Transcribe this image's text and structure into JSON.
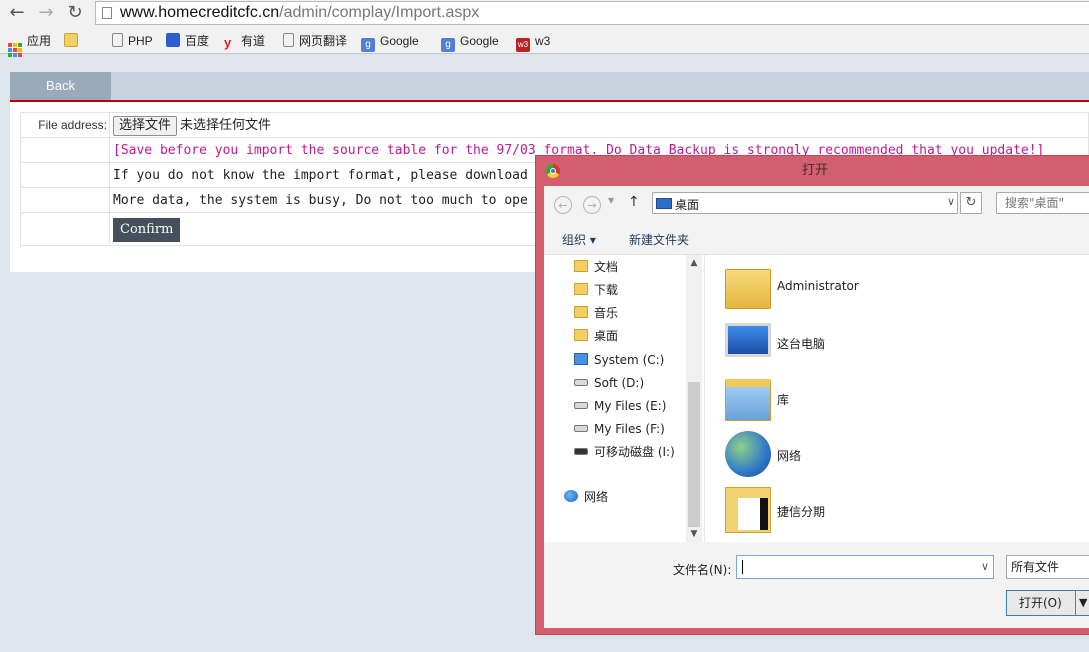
{
  "browser": {
    "url_host": "www.homecreditcfc.cn",
    "url_path": "/admin/complay/Import.aspx",
    "bookmarks": [
      {
        "label": "应用",
        "icon": "apps-icon"
      },
      {
        "label": "",
        "icon": "folder-icon"
      },
      {
        "label": "PHP",
        "icon": "page-icon"
      },
      {
        "label": "百度",
        "icon": "baidu-paw-icon"
      },
      {
        "label": "有道",
        "icon": "youdao-icon"
      },
      {
        "label": "网页翻译",
        "icon": "page-icon"
      },
      {
        "label": "Google",
        "icon": "google-icon"
      },
      {
        "label": "Google",
        "icon": "google-icon"
      },
      {
        "label": "w3",
        "icon": "w3-icon"
      }
    ]
  },
  "page": {
    "back_label": "Back",
    "file_label": "File address:",
    "choose_file": "选择文件",
    "no_file": "未选择任何文件",
    "warning": "[Save before you import the source table for the 97/03 format. Do Data Backup is strongly recommended that you update!]",
    "info1": "If you do not know the import format, please download",
    "info2": "More data, the system is busy, Do not too much to ope",
    "confirm_label": "Confirm"
  },
  "dialog": {
    "title": "打开",
    "address": "桌面",
    "search_placeholder": "搜索\"桌面\"",
    "organize": "组织 ▾",
    "new_folder": "新建文件夹",
    "nav_items": [
      {
        "label": "文档",
        "type": "folder"
      },
      {
        "label": "下载",
        "type": "folder"
      },
      {
        "label": "音乐",
        "type": "folder"
      },
      {
        "label": "桌面",
        "type": "folder"
      },
      {
        "label": "System (C:)",
        "type": "system-drive"
      },
      {
        "label": "Soft (D:)",
        "type": "drive"
      },
      {
        "label": "My Files (E:)",
        "type": "drive"
      },
      {
        "label": "My Files (F:)",
        "type": "drive"
      },
      {
        "label": "可移动磁盘 (I:)",
        "type": "drive"
      },
      {
        "label": "网络",
        "type": "network"
      }
    ],
    "items": [
      {
        "label": "Administrator",
        "icon": "user-folder-icon"
      },
      {
        "label": "这台电脑",
        "icon": "computer-icon"
      },
      {
        "label": "库",
        "icon": "library-icon"
      },
      {
        "label": "网络",
        "icon": "network-icon"
      },
      {
        "label": "捷信分期",
        "icon": "shortcut-folder-icon"
      }
    ],
    "filename_label": "文件名(N):",
    "filename_value": "",
    "filter": "所有文件",
    "open_label": "打开(O)"
  }
}
